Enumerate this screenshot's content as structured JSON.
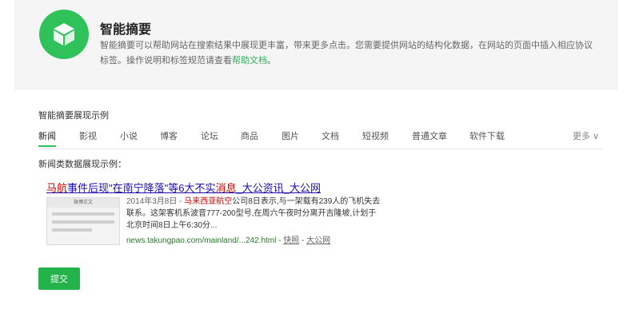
{
  "header": {
    "title": "智能摘要",
    "description_prefix": "智能摘要可以帮助网站在搜索结果中展现更丰富，带来更多点击。您需要提供网站的结构化数据，在网站的页面中插入相应协议标签。操作说明和标签规范请查看",
    "help_link": "帮助文档",
    "description_suffix": "。",
    "accent": "#2fc25b"
  },
  "section": {
    "title": "智能摘要展现示例",
    "tabs": [
      "新闻",
      "影视",
      "小说",
      "博客",
      "论坛",
      "商品",
      "图片",
      "文档",
      "短视频",
      "普通文章",
      "软件下载"
    ],
    "more": "更多 ∨",
    "example_label": "新闻类数据展现示例："
  },
  "result": {
    "title_part1": "马航",
    "title_part2": "事件后现\"",
    "title_part3": "在南宁降落\"等6大不实",
    "title_part4": "消息",
    "title_part5": "_大公资讯_大公网",
    "thumbnail_header": "微博正文",
    "date": "2014年3月8日 -",
    "airline": "马来西亚航空",
    "snippet_rest": "公司8日表示,与一架载有239人的飞机失去联系。这架客机系波音777-200型号,在周六午夜时分离开吉隆坡,计划于北京时间8日上午6:30分...",
    "url": "news.takungpao.com/mainland/...242.html",
    "sep1": " - ",
    "cache": "快照",
    "sep2": " - ",
    "source": "大公网"
  },
  "actions": {
    "submit": "提交"
  }
}
